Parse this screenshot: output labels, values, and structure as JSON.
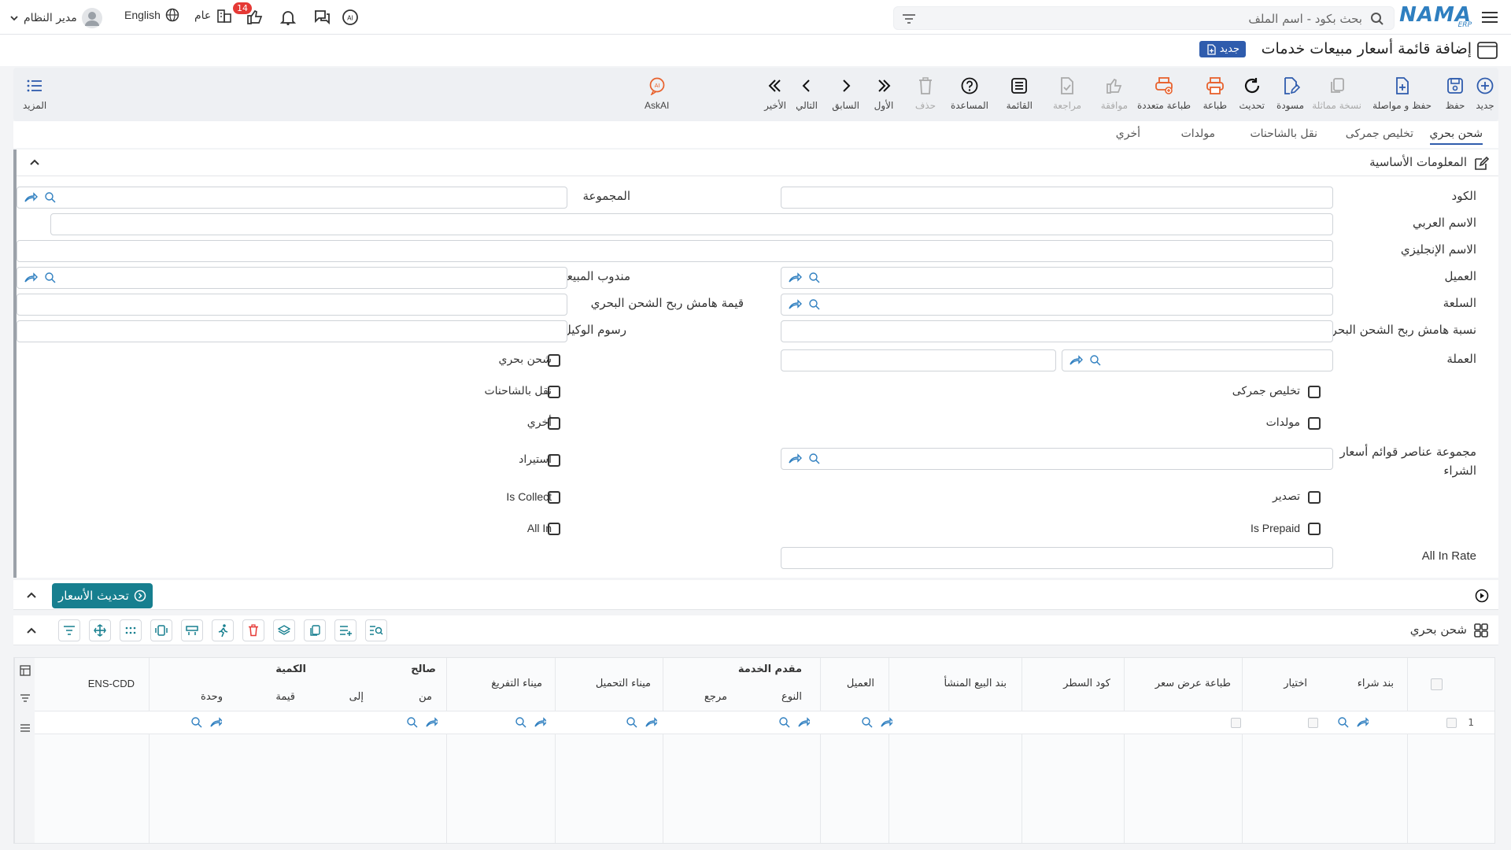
{
  "topbar": {
    "logo_text": "NAMA",
    "logo_sub": "ERP",
    "search_placeholder": "بحث بكود - اسم الملف",
    "user_name": "مدير النظام",
    "language": "English",
    "branch": "عام",
    "notification_count": "14"
  },
  "page": {
    "title": "إضافة قائمة أسعار مبيعات خدمات",
    "new_badge": "جديد"
  },
  "toolbar": {
    "new": "جديد",
    "save": "حفظ",
    "save_continue": "حفظ و مواصلة",
    "copy_similar": "نسخة مماثلة",
    "draft": "مسودة",
    "refresh": "تحديث",
    "print": "طباعة",
    "multi_print": "طباعة متعددة",
    "approve": "موافقة",
    "review": "مراجعة",
    "list": "القائمة",
    "help": "المساعدة",
    "delete": "حذف",
    "first": "الأول",
    "previous": "السابق",
    "next": "التالي",
    "last": "الأخير",
    "askai": "AskAI",
    "more": "المزيد"
  },
  "tabs": [
    "شحن بحري",
    "تخليص جمركى",
    "نقل بالشاحنات",
    "مولدات",
    "أخري"
  ],
  "section": {
    "title": "المعلومات الأساسية"
  },
  "form": {
    "code": "الكود",
    "group": "المجموعة",
    "arabic_name": "الاسم العربي",
    "english_name": "الاسم الإنجليزي",
    "customer": "العميل",
    "sales_rep": "مندوب المبيعات",
    "commodity": "السلعة",
    "sea_margin_value": "قيمة هامش ربح الشحن البحري",
    "sea_margin_pct": "نسبة هامش ربح الشحن البحري",
    "agent_fees": "رسوم الوكيل",
    "currency": "العملة",
    "purchase_group": "مجموعة عناصر قوائم أسعار الشراء",
    "all_in_rate": "All In Rate"
  },
  "checkboxes": {
    "sea_freight": "شحن بحري",
    "trucking": "نقل بالشاحنات",
    "other": "أخري",
    "import": "استيراد",
    "is_collect": "Is Collect",
    "all_in": "All In",
    "customs": "تخليص جمركى",
    "generators": "مولدات",
    "export": "تصدير",
    "is_prepaid": "Is Prepaid"
  },
  "update_prices": "تحديث الأسعار",
  "grid": {
    "title": "شحن بحري",
    "headers": {
      "purchase_item": "بند شراء",
      "select": "اختيار",
      "print_quote": "طباعة عرض سعر",
      "line_code": "كود السطر",
      "origin_sale_item": "بند البيع المنشأ",
      "customer": "العميل",
      "service_provider": "مقدم الخدمة",
      "type": "النوع",
      "reference": "مرجع",
      "loading_port": "ميناء التحميل",
      "discharge_port": "ميناء التفريغ",
      "valid": "صالح",
      "from": "من",
      "to": "إلى",
      "quantity": "الكمية",
      "value": "قيمة",
      "unit": "وحدة",
      "ens_cdd": "ENS-CDD"
    },
    "rows": [
      {
        "index": "1"
      }
    ]
  },
  "colors": {
    "primary": "#2f5cad",
    "accent_teal": "#177f8f",
    "print_orange": "#e8612c",
    "badge_red": "#e53935"
  }
}
